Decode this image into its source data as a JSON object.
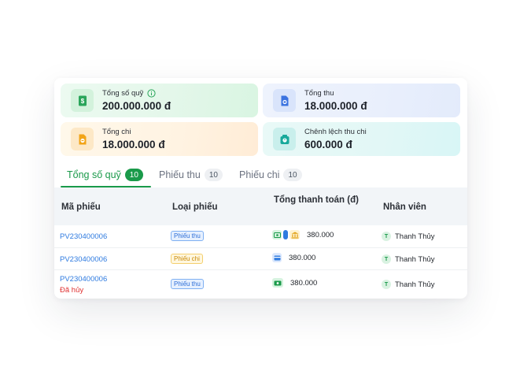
{
  "stats": [
    {
      "label": "Tổng số quỹ",
      "value": "200.000.000 đ",
      "icon": "money-note-icon",
      "has_info": true
    },
    {
      "label": "Tổng thu",
      "value": "18.000.000 đ",
      "icon": "receipt-in-icon"
    },
    {
      "label": "Tổng chi",
      "value": "18.000.000 đ",
      "icon": "receipt-out-icon"
    },
    {
      "label": "Chênh lệch thu chi",
      "value": "600.000 đ",
      "icon": "scale-icon"
    }
  ],
  "tabs": [
    {
      "label": "Tổng số quỹ",
      "count": "10",
      "active": true
    },
    {
      "label": "Phiếu thu",
      "count": "10",
      "active": false
    },
    {
      "label": "Phiếu chi",
      "count": "10",
      "active": false
    }
  ],
  "table": {
    "headers": [
      "Mã phiếu",
      "Loại phiếu",
      "Tổng thanh toán (đ)",
      "Nhân viên"
    ],
    "rows": [
      {
        "code": "PV230400006",
        "status": "",
        "type": "Phiếu thu",
        "methods": [
          "cash",
          "card",
          "bank"
        ],
        "amount": "380.000",
        "staff_initial": "T",
        "staff": "Thanh Thủy"
      },
      {
        "code": "PV230400006",
        "status": "",
        "type": "Phiếu chi",
        "methods": [
          "card"
        ],
        "amount": "380.000",
        "staff_initial": "T",
        "staff": "Thanh Thủy"
      },
      {
        "code": "PV230400006",
        "status": "Đã hủy",
        "type": "Phiếu thu",
        "methods": [
          "cash"
        ],
        "amount": "380.000",
        "staff_initial": "T",
        "staff": "Thanh Thủy"
      }
    ]
  },
  "colors": {
    "accent": "#1a9a4a",
    "link": "#2f7be0",
    "danger": "#e03131",
    "header_bg": "#f2f5f8"
  }
}
